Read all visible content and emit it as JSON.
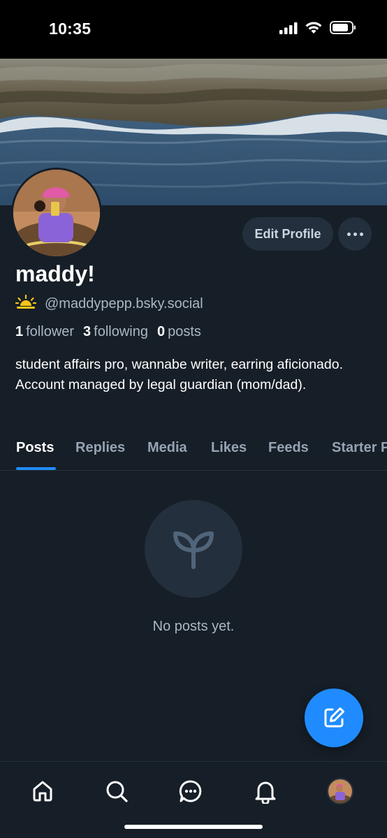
{
  "status_bar": {
    "time": "10:35",
    "icons": [
      "signal-icon",
      "wifi-icon",
      "battery-icon"
    ]
  },
  "profile": {
    "display_name": "maddy!",
    "handle": "@maddypepp.bsky.social",
    "handle_icon": "sunrise-icon",
    "edit_button_label": "Edit Profile",
    "more_button_icon": "ellipsis-icon",
    "stats": {
      "followers_count": "1",
      "followers_label": "follower",
      "following_count": "3",
      "following_label": "following",
      "posts_count": "0",
      "posts_label": "posts"
    },
    "bio": "student affairs pro, wannabe writer, earring aficionado. Account managed by legal guardian (mom/dad)."
  },
  "tabs": [
    {
      "label": "Posts",
      "active": true
    },
    {
      "label": "Replies",
      "active": false
    },
    {
      "label": "Media",
      "active": false
    },
    {
      "label": "Likes",
      "active": false
    },
    {
      "label": "Feeds",
      "active": false
    },
    {
      "label": "Starter Packs",
      "active": false
    }
  ],
  "empty_state": {
    "icon": "seedling-icon",
    "text": "No posts yet."
  },
  "fab": {
    "icon": "compose-icon"
  },
  "bottom_nav": [
    {
      "name": "home",
      "icon": "home-icon"
    },
    {
      "name": "search",
      "icon": "search-icon"
    },
    {
      "name": "chat",
      "icon": "chat-icon"
    },
    {
      "name": "notifications",
      "icon": "bell-icon"
    },
    {
      "name": "profile",
      "icon": "avatar"
    }
  ],
  "colors": {
    "background": "#161e27",
    "accent": "#208bfe",
    "secondary_text": "#aab7c4",
    "button_bg": "#232f3c"
  }
}
